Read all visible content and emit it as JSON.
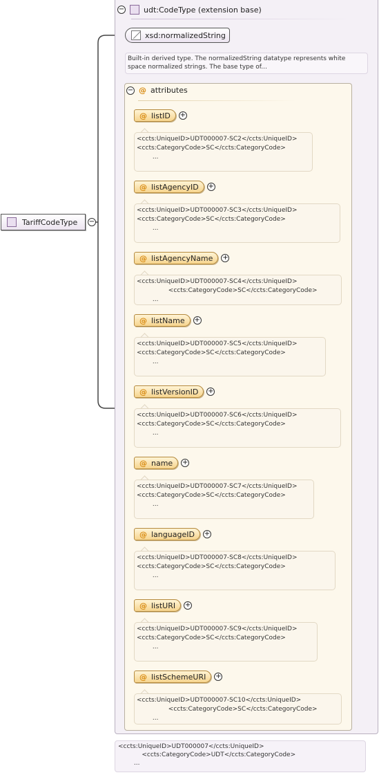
{
  "type_header": {
    "label": "udt:CodeType (extension base)"
  },
  "base_type": {
    "label": "xsd:normalizedString"
  },
  "base_description": "Built-in derived type. The normalizedString datatype represents white space normalized strings. The base type of...",
  "attributes_group": {
    "label": "attributes"
  },
  "root_element": {
    "label": "TariffCodeType"
  },
  "attributes": [
    {
      "name": "listID",
      "doc": [
        "<ccts:UniqueID>UDT000007-SC2</ccts:UniqueID>",
        "",
        "<ccts:CategoryCode>SC</ccts:CategoryCode>",
        "        ..."
      ]
    },
    {
      "name": "listAgencyID",
      "doc": [
        "<ccts:UniqueID>UDT000007-SC3</ccts:UniqueID>",
        "",
        "<ccts:CategoryCode>SC</ccts:CategoryCode>",
        "        ..."
      ]
    },
    {
      "name": "listAgencyName",
      "doc": [
        "<ccts:UniqueID>UDT000007-SC4</ccts:UniqueID>",
        "                <ccts:CategoryCode>SC</ccts:CategoryCode>",
        "        ..."
      ]
    },
    {
      "name": "listName",
      "doc": [
        "<ccts:UniqueID>UDT000007-SC5</ccts:UniqueID>",
        "",
        "<ccts:CategoryCode>SC</ccts:CategoryCode>",
        "        ..."
      ]
    },
    {
      "name": "listVersionID",
      "doc": [
        "<ccts:UniqueID>UDT000007-SC6</ccts:UniqueID>",
        "",
        "<ccts:CategoryCode>SC</ccts:CategoryCode>",
        "        ..."
      ]
    },
    {
      "name": "name",
      "doc": [
        "<ccts:UniqueID>UDT000007-SC7</ccts:UniqueID>",
        "",
        "<ccts:CategoryCode>SC</ccts:CategoryCode>",
        "        ..."
      ]
    },
    {
      "name": "languageID",
      "doc": [
        "<ccts:UniqueID>UDT000007-SC8</ccts:UniqueID>",
        "",
        "<ccts:CategoryCode>SC</ccts:CategoryCode>",
        "        ..."
      ]
    },
    {
      "name": "listURI",
      "doc": [
        "<ccts:UniqueID>UDT000007-SC9</ccts:UniqueID>",
        "",
        "<ccts:CategoryCode>SC</ccts:CategoryCode>",
        "        ..."
      ]
    },
    {
      "name": "listSchemeURI",
      "doc": [
        "<ccts:UniqueID>UDT000007-SC10</ccts:UniqueID>",
        "                <ccts:CategoryCode>SC</ccts:CategoryCode>",
        "        ..."
      ]
    }
  ],
  "bottom_doc": [
    "<ccts:UniqueID>UDT000007</ccts:UniqueID>",
    "            <ccts:CategoryCode>UDT</ccts:CategoryCode>",
    "        ..."
  ],
  "symbols": {
    "collapse": "−",
    "expand": "+",
    "attr": "@"
  }
}
